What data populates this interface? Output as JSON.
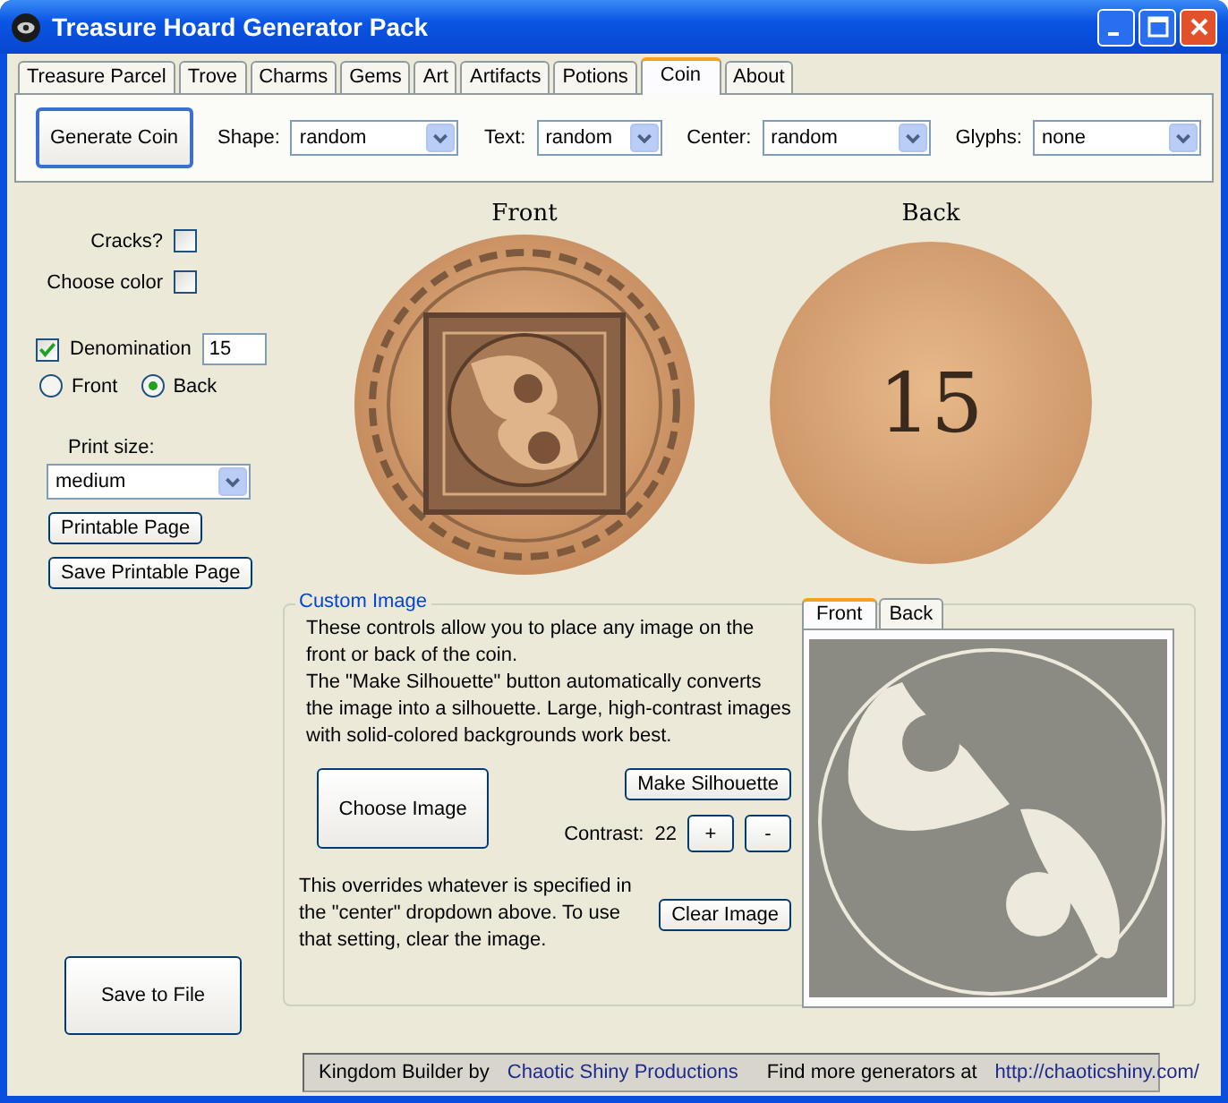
{
  "window": {
    "title": "Treasure Hoard Generator Pack"
  },
  "tabs": [
    {
      "label": "Treasure Parcel",
      "selected": false
    },
    {
      "label": "Trove",
      "selected": false
    },
    {
      "label": "Charms",
      "selected": false
    },
    {
      "label": "Gems",
      "selected": false
    },
    {
      "label": "Art",
      "selected": false
    },
    {
      "label": "Artifacts",
      "selected": false
    },
    {
      "label": "Potions",
      "selected": false
    },
    {
      "label": "Coin",
      "selected": true
    },
    {
      "label": "About",
      "selected": false
    }
  ],
  "toolbar": {
    "generate_button": "Generate Coin",
    "dropdowns": [
      {
        "label": "Shape:",
        "value": "random"
      },
      {
        "label": "Text:",
        "value": "random"
      },
      {
        "label": "Center:",
        "value": "random"
      },
      {
        "label": "Glyphs:",
        "value": "none"
      }
    ]
  },
  "options": {
    "checkboxes": [
      {
        "label": "Cracks?",
        "checked": false
      },
      {
        "label": "Choose color",
        "checked": false
      }
    ],
    "denomination": {
      "label": "Denomination",
      "checked": true,
      "value": "15"
    },
    "sides": [
      {
        "label": "Front",
        "selected": false
      },
      {
        "label": "Back",
        "selected": true
      }
    ],
    "print_size": {
      "label": "Print size:",
      "value": "medium"
    },
    "buttons": [
      "Printable Page",
      "Save Printable Page"
    ],
    "save_button": "Save to File"
  },
  "coins": {
    "front_label": "Front",
    "back_label": "Back",
    "back_text": "15"
  },
  "custom_image": {
    "title": "Custom Image",
    "description": [
      "These controls allow you to place any image on the front or back of the coin.",
      "The \"Make Silhouette\" button automatically converts the image into a silhouette. Large, high-contrast  images with solid-colored backgrounds work best."
    ],
    "choose_button": "Choose Image",
    "silhouette_button": "Make Silhouette",
    "contrast_label": "Contrast:",
    "contrast_value": "22",
    "plus_button": "+",
    "minus_button": "-",
    "note": "This overrides whatever is specified in the \"center\" dropdown above. To use that setting, clear the image.",
    "clear_button": "Clear Image",
    "preview_tabs": [
      {
        "label": "Front",
        "selected": true
      },
      {
        "label": "Back",
        "selected": false
      }
    ]
  },
  "status_bar": {
    "text": "Kingdom Builder by",
    "link": "Chaotic Shiny Productions",
    "text_2": "Find more generators at",
    "link_2": "http://chaoticshiny.com/"
  }
}
